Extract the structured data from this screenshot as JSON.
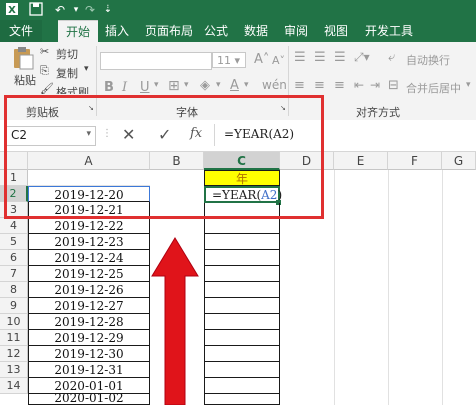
{
  "ribbon_tabs": [
    "文件",
    "开始",
    "插入",
    "页面布局",
    "公式",
    "数据",
    "审阅",
    "视图",
    "开发工具"
  ],
  "clipboard": {
    "cut": "剪切",
    "copy": "复制",
    "paste": "粘贴",
    "painter": "格式刷",
    "group_label": "剪贴板"
  },
  "font": {
    "size": "11",
    "group_label": "字体",
    "bold": "B",
    "italic": "I",
    "underline": "U",
    "grow": "A",
    "shrink": "A"
  },
  "alignment": {
    "wrap": "自动换行",
    "merge": "合并后居中",
    "group_label": "对齐方式"
  },
  "formula_bar": {
    "name_box": "C2",
    "fx": "fx",
    "formula": "=YEAR(A2)"
  },
  "columns": [
    "A",
    "B",
    "C",
    "D",
    "E",
    "F",
    "G"
  ],
  "rows": [
    "1",
    "2",
    "3",
    "4",
    "5",
    "6",
    "7",
    "8",
    "9",
    "10",
    "11",
    "12",
    "13",
    "14"
  ],
  "cells_a": [
    "",
    "2019-12-20",
    "2019-12-21",
    "2019-12-22",
    "2019-12-23",
    "2019-12-24",
    "2019-12-25",
    "2019-12-26",
    "2019-12-27",
    "2019-12-28",
    "2019-12-29",
    "2019-12-30",
    "2019-12-31",
    "2020-01-01",
    "2020-01-02"
  ],
  "c1": "年",
  "c2_formula": "=YEAR(",
  "c2_ref": "A2",
  "c2_close": ")",
  "colors": {
    "excel_green": "#217346",
    "highlight_box": "#e03030",
    "arrow": "#e0141a",
    "header_fill": "#ffff00",
    "ref_blue": "#3f6fc8"
  }
}
